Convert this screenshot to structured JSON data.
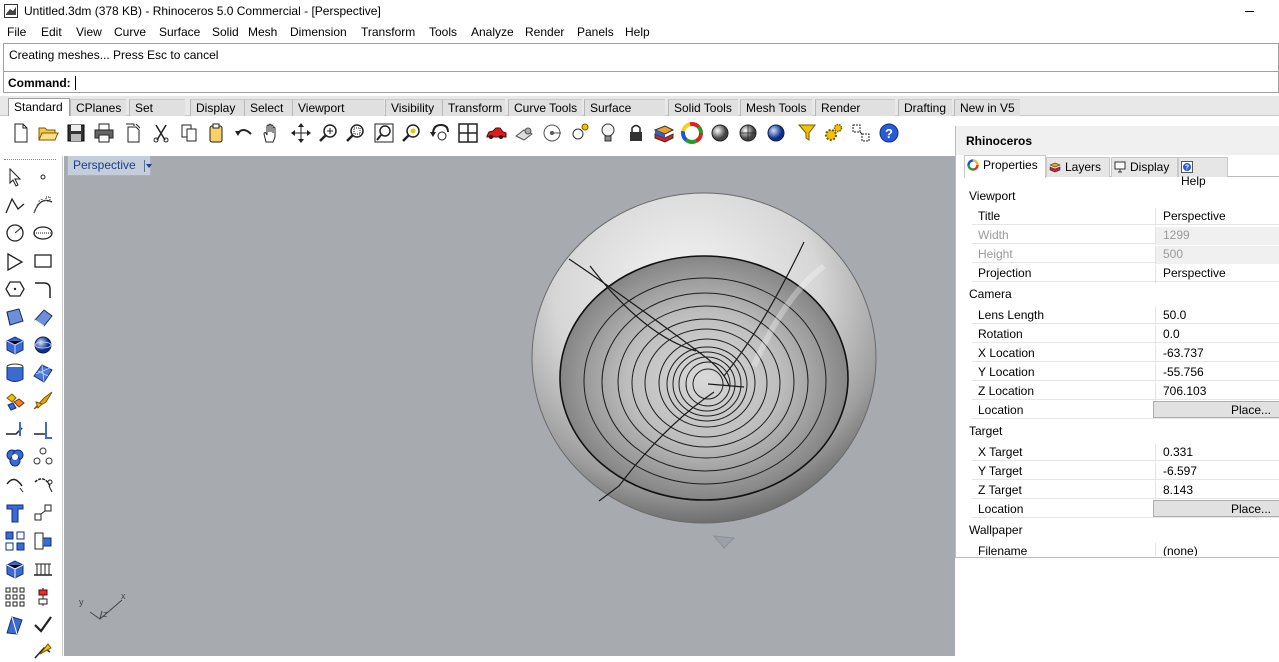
{
  "window": {
    "title": "Untitled.3dm (378 KB) - Rhinoceros 5.0 Commercial - [Perspective]"
  },
  "menu": [
    "File",
    "Edit",
    "View",
    "Curve",
    "Surface",
    "Solid",
    "Mesh",
    "Dimension",
    "Transform",
    "Tools",
    "Analyze",
    "Render",
    "Panels",
    "Help"
  ],
  "command": {
    "history": "Creating meshes... Press Esc to cancel",
    "prompt": "Command:"
  },
  "toolbar_tabs": [
    "Standard",
    "CPlanes",
    "Set View",
    "Display",
    "Select",
    "Viewport Layout",
    "Visibility",
    "Transform",
    "Curve Tools",
    "Surface Tools",
    "Solid Tools",
    "Mesh Tools",
    "Render Tools",
    "Drafting",
    "New in V5"
  ],
  "toolbar_icons": [
    "new-file-icon",
    "open-file-icon",
    "save-icon",
    "print-icon",
    "import-icon",
    "cut-icon",
    "copy-icon",
    "paste-icon",
    "undo-icon",
    "pan-hand-icon",
    "rotate-view-icon",
    "zoom-icon",
    "zoom-window-icon",
    "zoom-extents-icon",
    "zoom-selected-icon",
    "rotate-3d-icon",
    "four-viewports-icon",
    "car-icon",
    "camera-icon",
    "target-icon",
    "point-bulb-icon",
    "light-bulb-icon",
    "lock-icon",
    "layer-icon",
    "color-wheel-icon",
    "shaded-sphere-icon",
    "rendered-sphere-icon",
    "blue-sphere-icon",
    "filter-icon",
    "gear-icon",
    "snap-grid-icon",
    "help-icon"
  ],
  "left_tools": [
    [
      "select-arrow-icon",
      "point-icon"
    ],
    [
      "polyline-icon",
      "curve-cv-icon"
    ],
    [
      "circle-icon",
      "ellipse-icon"
    ],
    [
      "arc-icon",
      "rectangle-icon"
    ],
    [
      "polygon-icon",
      "fillet-curve-icon"
    ],
    [
      "surface-corner-icon",
      "surface-extrude-icon"
    ],
    [
      "box-icon",
      "sphere-icon"
    ],
    [
      "cylinder-icon",
      "mesh-surface-icon"
    ],
    [
      "explode-icon",
      "trim-icon"
    ],
    [
      "split-icon",
      "join-icon"
    ],
    [
      "boolean-union-icon",
      "array-icon"
    ],
    [
      "offset-curve-icon",
      "rebuild-icon"
    ],
    [
      "text-icon",
      "dimension-icon"
    ],
    [
      "group-icon",
      "block-icon"
    ],
    [
      "analyze-cube-icon",
      "grid-snap-icon"
    ],
    [
      "points-array-icon",
      "history-icon"
    ],
    [
      "paint-icon",
      "check-icon"
    ]
  ],
  "viewport": {
    "title": "Perspective",
    "axis_x": "x",
    "axis_y": "y",
    "axis_z": "z"
  },
  "panel": {
    "title": "Rhinoceros",
    "tabs": [
      "Properties",
      "Layers",
      "Display",
      "Help"
    ],
    "sections": {
      "viewport": "Viewport",
      "camera": "Camera",
      "target": "Target",
      "wallpaper": "Wallpaper"
    },
    "rows": {
      "title_k": "Title",
      "title_v": "Perspective",
      "width_k": "Width",
      "width_v": "1299",
      "height_k": "Height",
      "height_v": "500",
      "projection_k": "Projection",
      "projection_v": "Perspective",
      "lens_k": "Lens Length",
      "lens_v": "50.0",
      "rotation_k": "Rotation",
      "rotation_v": "0.0",
      "xloc_k": "X Location",
      "xloc_v": "-63.737",
      "yloc_k": "Y Location",
      "yloc_v": "-55.756",
      "zloc_k": "Z Location",
      "zloc_v": "706.103",
      "loc_k": "Location",
      "loc_btn": "Place...",
      "xt_k": "X Target",
      "xt_v": "0.331",
      "yt_k": "Y Target",
      "yt_v": "-6.597",
      "zt_k": "Z Target",
      "zt_v": "8.143",
      "tloc_k": "Location",
      "tloc_btn": "Place...",
      "filename_k": "Filename",
      "filename_v": "(none)"
    }
  },
  "colors": {
    "viewport_bg": "#a7abb0",
    "viewport_label": "#1a3e8a",
    "panel_bg": "#f0f0f0"
  }
}
